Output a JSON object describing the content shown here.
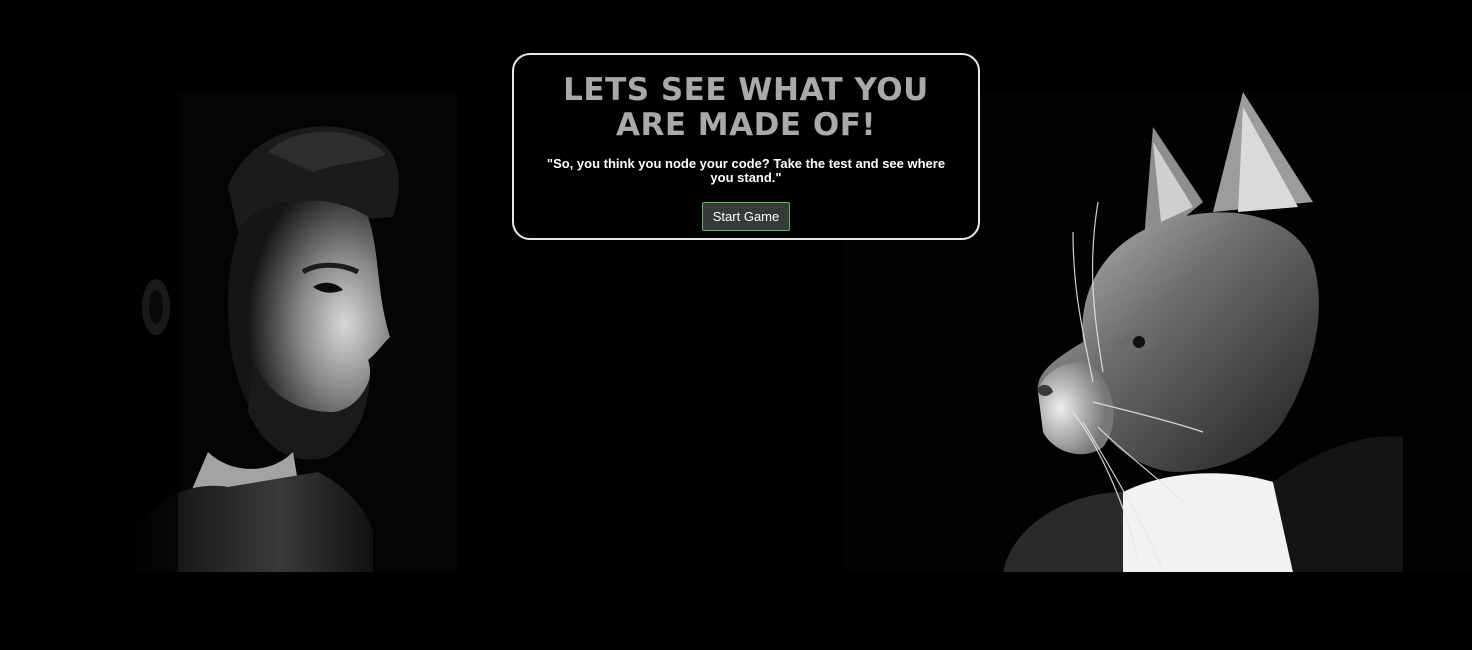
{
  "intro": {
    "headline": "LETS SEE WHAT YOU ARE MADE OF!",
    "tagline": "\"So, you think you node your code? Take the test and see where you stand.\"",
    "start_button_label": "Start Game"
  },
  "images": {
    "left": "man-profile-portrait",
    "right": "cat-profile-portrait"
  },
  "colors": {
    "background": "#000000",
    "headline": "#a9a9a9",
    "card_border": "#e8e8e8",
    "button_bg": "#373b38",
    "button_border": "#58b35a",
    "text": "#ffffff"
  }
}
